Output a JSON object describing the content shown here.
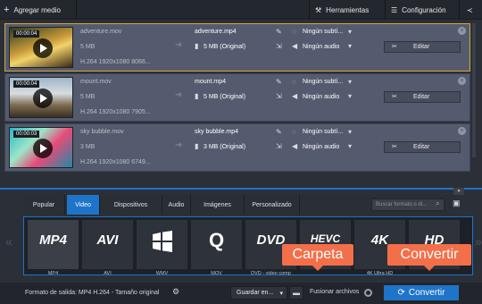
{
  "toolbar": {
    "add_media": "Agregar medio",
    "tools": "Herramientas",
    "settings": "Configuración"
  },
  "files": [
    {
      "time": "00:00:04",
      "source": "adventure.mov",
      "size": "5 MB",
      "codec": "H.264 1920x1080 8066...",
      "output": "adventure.mp4",
      "out_size": "5 MB (Original)",
      "subtitles": "Ningún subtí...",
      "audio": "Ningún audio",
      "edit": "Editar"
    },
    {
      "time": "00:00:04",
      "source": "mount.mov",
      "size": "5 MB",
      "codec": "H.264 1920x1080 7905...",
      "output": "mount.mp4",
      "out_size": "5 MB (Original)",
      "subtitles": "Ningún subtí...",
      "audio": "Ningún audio",
      "edit": "Editar"
    },
    {
      "time": "00:00:03",
      "source": "sky bubble.mov",
      "size": "3 MB",
      "codec": "H.264 1920x1080 6749...",
      "output": "sky bubble.mp4",
      "out_size": "3 MB (Original)",
      "subtitles": "Ningún subtí...",
      "audio": "Ningún audio",
      "edit": "Editar"
    }
  ],
  "tabs": [
    "Popular",
    "Video",
    "Dispositivos",
    "Audio",
    "Imágenes",
    "Personalizado"
  ],
  "search_placeholder": "Buscar formato o di...",
  "formats": [
    {
      "name": "MP4",
      "label": "MP4"
    },
    {
      "name": "AVI",
      "label": "AVI"
    },
    {
      "name": "",
      "label": "WMV"
    },
    {
      "name": "Q",
      "label": "MOV"
    },
    {
      "name": "DVD",
      "label": "DVD - video comp"
    },
    {
      "name": "HEVC",
      "label": ""
    },
    {
      "name": "4K",
      "label": "4K Ultra HD"
    },
    {
      "name": "HD",
      "label": ""
    }
  ],
  "bottom": {
    "output_format": "Formato de salida: MP4 H.264 - Tamaño original",
    "save_to": "Guardar en...",
    "merge": "Fusionar archivos",
    "convert": "Convertir"
  },
  "callouts": {
    "folder": "Carpeta",
    "convert": "Convertir"
  }
}
